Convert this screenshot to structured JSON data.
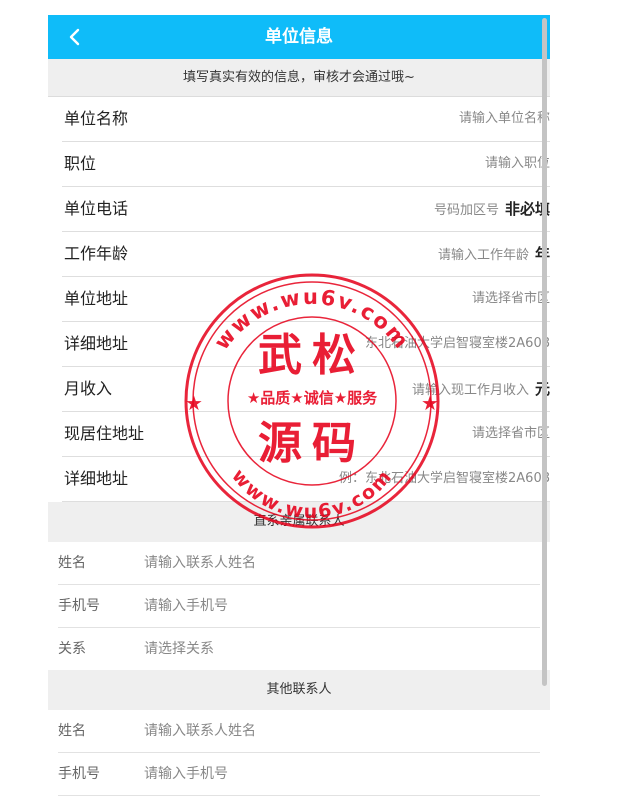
{
  "header": {
    "title": "单位信息",
    "back_icon": "chevron-left-icon"
  },
  "notice": "填写真实有效的信息，审核才会通过哦~",
  "fields": [
    {
      "label": "单位名称",
      "placeholder": "请输入单位名称",
      "suffix": ""
    },
    {
      "label": "职位",
      "placeholder": "请输入职位",
      "suffix": ""
    },
    {
      "label": "单位电话",
      "placeholder": "号码加区号",
      "suffix": "非必填"
    },
    {
      "label": "工作年龄",
      "placeholder": "请输入工作年龄",
      "suffix": "年"
    },
    {
      "label": "单位地址",
      "placeholder": "请选择省市区",
      "suffix": ""
    },
    {
      "label": "详细地址",
      "placeholder": "东北石油大学启智寝室楼2A608",
      "suffix": ""
    },
    {
      "label": "月收入",
      "placeholder": "请输入现工作月收入",
      "suffix": "元"
    },
    {
      "label": "现居住地址",
      "placeholder": "请选择省市区",
      "suffix": ""
    },
    {
      "label": "详细地址",
      "placeholder": "例：东北石油大学启智寝室楼2A608",
      "suffix": ""
    }
  ],
  "direct_contact": {
    "title": "直系亲属联系人",
    "rows": [
      {
        "label": "姓名",
        "placeholder": "请输入联系人姓名"
      },
      {
        "label": "手机号",
        "placeholder": "请输入手机号"
      },
      {
        "label": "关系",
        "placeholder": "请选择关系"
      }
    ]
  },
  "other_contact": {
    "title": "其他联系人",
    "rows": [
      {
        "label": "姓名",
        "placeholder": "请输入联系人姓名"
      },
      {
        "label": "手机号",
        "placeholder": "请输入手机号"
      }
    ]
  },
  "watermark": {
    "top_text": "www.wu6v.com",
    "bottom_text": "www.wu6v.com",
    "name_top": "武松",
    "name_bottom": "源码",
    "slogan": "★品质★诚信★服务",
    "color": "#e6001a"
  },
  "colors": {
    "header": "#0fbcf9",
    "section_bg": "#efefef"
  }
}
